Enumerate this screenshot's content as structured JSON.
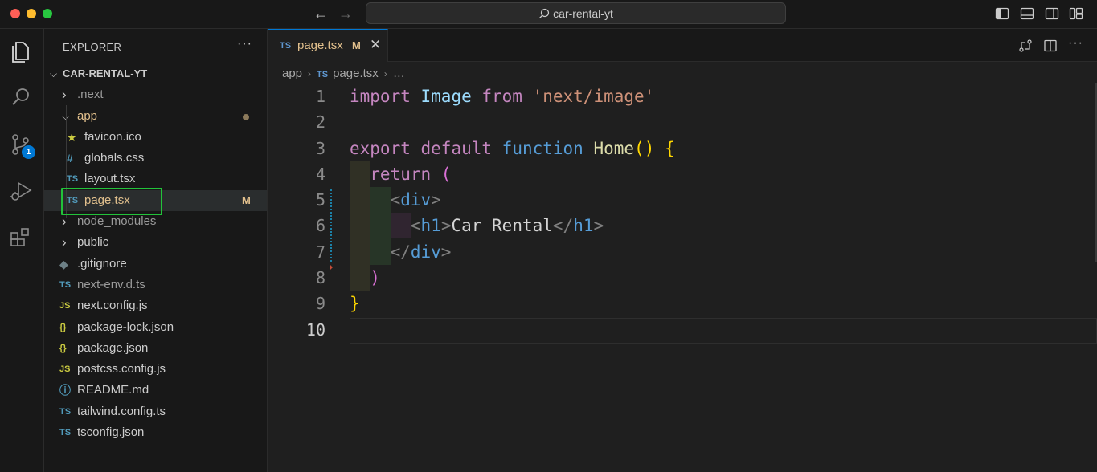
{
  "window": {
    "search_text": "car-rental-yt"
  },
  "activity_bar": {
    "source_control_badge": "1"
  },
  "explorer": {
    "title": "EXPLORER",
    "more_label": "···",
    "root": "CAR-RENTAL-YT",
    "items": [
      {
        "label": ".next",
        "kind": "folder",
        "expanded": false,
        "depth": 1,
        "dim": true
      },
      {
        "label": "app",
        "kind": "folder",
        "expanded": true,
        "depth": 1,
        "modified_dot": true,
        "color": "#e2c08d"
      },
      {
        "label": "favicon.ico",
        "kind": "file",
        "icon": "★",
        "icon_color": "#cbcb41",
        "depth": 2
      },
      {
        "label": "globals.css",
        "kind": "file",
        "icon": "#",
        "icon_color": "#519aba",
        "depth": 2
      },
      {
        "label": "layout.tsx",
        "kind": "file",
        "icon": "TS",
        "icon_color": "#519aba",
        "depth": 2
      },
      {
        "label": "page.tsx",
        "kind": "file",
        "icon": "TS",
        "icon_color": "#519aba",
        "depth": 2,
        "selected": true,
        "flag": "M",
        "color": "#e2c08d"
      },
      {
        "label": "node_modules",
        "kind": "folder",
        "expanded": false,
        "depth": 1,
        "dim": true
      },
      {
        "label": "public",
        "kind": "folder",
        "expanded": false,
        "depth": 1
      },
      {
        "label": ".gitignore",
        "kind": "file",
        "icon": "◆",
        "icon_color": "#6d8086",
        "depth": 1
      },
      {
        "label": "next-env.d.ts",
        "kind": "file",
        "icon": "TS",
        "icon_color": "#519aba",
        "depth": 1,
        "dim": true
      },
      {
        "label": "next.config.js",
        "kind": "file",
        "icon": "JS",
        "icon_color": "#cbcb41",
        "depth": 1
      },
      {
        "label": "package-lock.json",
        "kind": "file",
        "icon": "{}",
        "icon_color": "#cbcb41",
        "depth": 1
      },
      {
        "label": "package.json",
        "kind": "file",
        "icon": "{}",
        "icon_color": "#cbcb41",
        "depth": 1
      },
      {
        "label": "postcss.config.js",
        "kind": "file",
        "icon": "JS",
        "icon_color": "#cbcb41",
        "depth": 1
      },
      {
        "label": "README.md",
        "kind": "file",
        "icon": "ⓘ",
        "icon_color": "#519aba",
        "depth": 1
      },
      {
        "label": "tailwind.config.ts",
        "kind": "file",
        "icon": "TS",
        "icon_color": "#519aba",
        "depth": 1
      },
      {
        "label": "tsconfig.json",
        "kind": "file",
        "icon": "TS",
        "icon_color": "#519aba",
        "depth": 1
      }
    ]
  },
  "editor": {
    "tab": {
      "icon": "TS",
      "name": "page.tsx",
      "flag": "M",
      "close": "✕"
    },
    "breadcrumb": {
      "folder": "app",
      "icon": "TS",
      "file": "page.tsx",
      "rest": "…"
    },
    "active_line": 10,
    "lines": [
      {
        "n": "1",
        "tokens": [
          [
            "import ",
            "kw-purple"
          ],
          [
            "Image ",
            "ident"
          ],
          [
            "from ",
            "kw-purple"
          ],
          [
            "'next/image'",
            "str"
          ]
        ]
      },
      {
        "n": "2",
        "tokens": []
      },
      {
        "n": "3",
        "tokens": [
          [
            "export ",
            "kw-purple"
          ],
          [
            "default ",
            "kw-purple"
          ],
          [
            "function ",
            "kw-blue"
          ],
          [
            "Home",
            "fn"
          ],
          [
            "() ",
            "brace-y"
          ],
          [
            "{",
            "brace-y"
          ]
        ]
      },
      {
        "n": "4",
        "tokens": [
          [
            "  return ",
            "kw-purple"
          ],
          [
            "(",
            "brace-p"
          ]
        ]
      },
      {
        "n": "5",
        "tokens": [
          [
            "    <",
            "tagbr"
          ],
          [
            "div",
            "tag"
          ],
          [
            ">",
            "tagbr"
          ]
        ]
      },
      {
        "n": "6",
        "tokens": [
          [
            "      <",
            "tagbr"
          ],
          [
            "h1",
            "tag"
          ],
          [
            ">",
            "tagbr"
          ],
          [
            "Car Rental",
            "txt"
          ],
          [
            "</",
            "tagbr"
          ],
          [
            "h1",
            "tag"
          ],
          [
            ">",
            "tagbr"
          ]
        ]
      },
      {
        "n": "7",
        "tokens": [
          [
            "    </",
            "tagbr"
          ],
          [
            "div",
            "tag"
          ],
          [
            ">",
            "tagbr"
          ]
        ]
      },
      {
        "n": "8",
        "tokens": [
          [
            "  )",
            "brace-p"
          ]
        ]
      },
      {
        "n": "9",
        "tokens": [
          [
            "}",
            "brace-y"
          ]
        ]
      },
      {
        "n": "10",
        "tokens": []
      }
    ]
  }
}
